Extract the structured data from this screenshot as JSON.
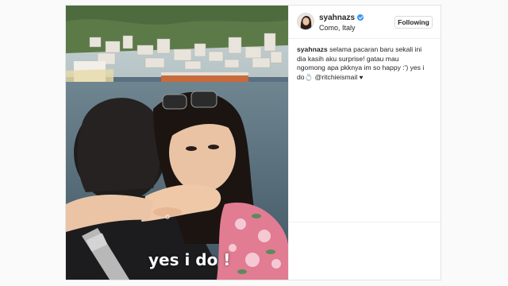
{
  "post": {
    "username": "syahnazs",
    "location": "Como, Italy",
    "follow_label": "Following",
    "caption_user": "syahnazs",
    "caption_text": "selama pacaran baru sekali ini dia kasih aku surprise! gatau mau ngomong apa pkknya im so happy :') yes i do💍 @ritchieismail",
    "caption_heart": "♥",
    "photo_overlay_text": "yes i do !"
  },
  "icons": {
    "verified": "verified-badge-icon",
    "heart": "heart-icon",
    "ring": "ring-emoji"
  },
  "colors": {
    "verified_blue": "#3897f0",
    "border": "#dbdbdb",
    "text": "#262626"
  }
}
